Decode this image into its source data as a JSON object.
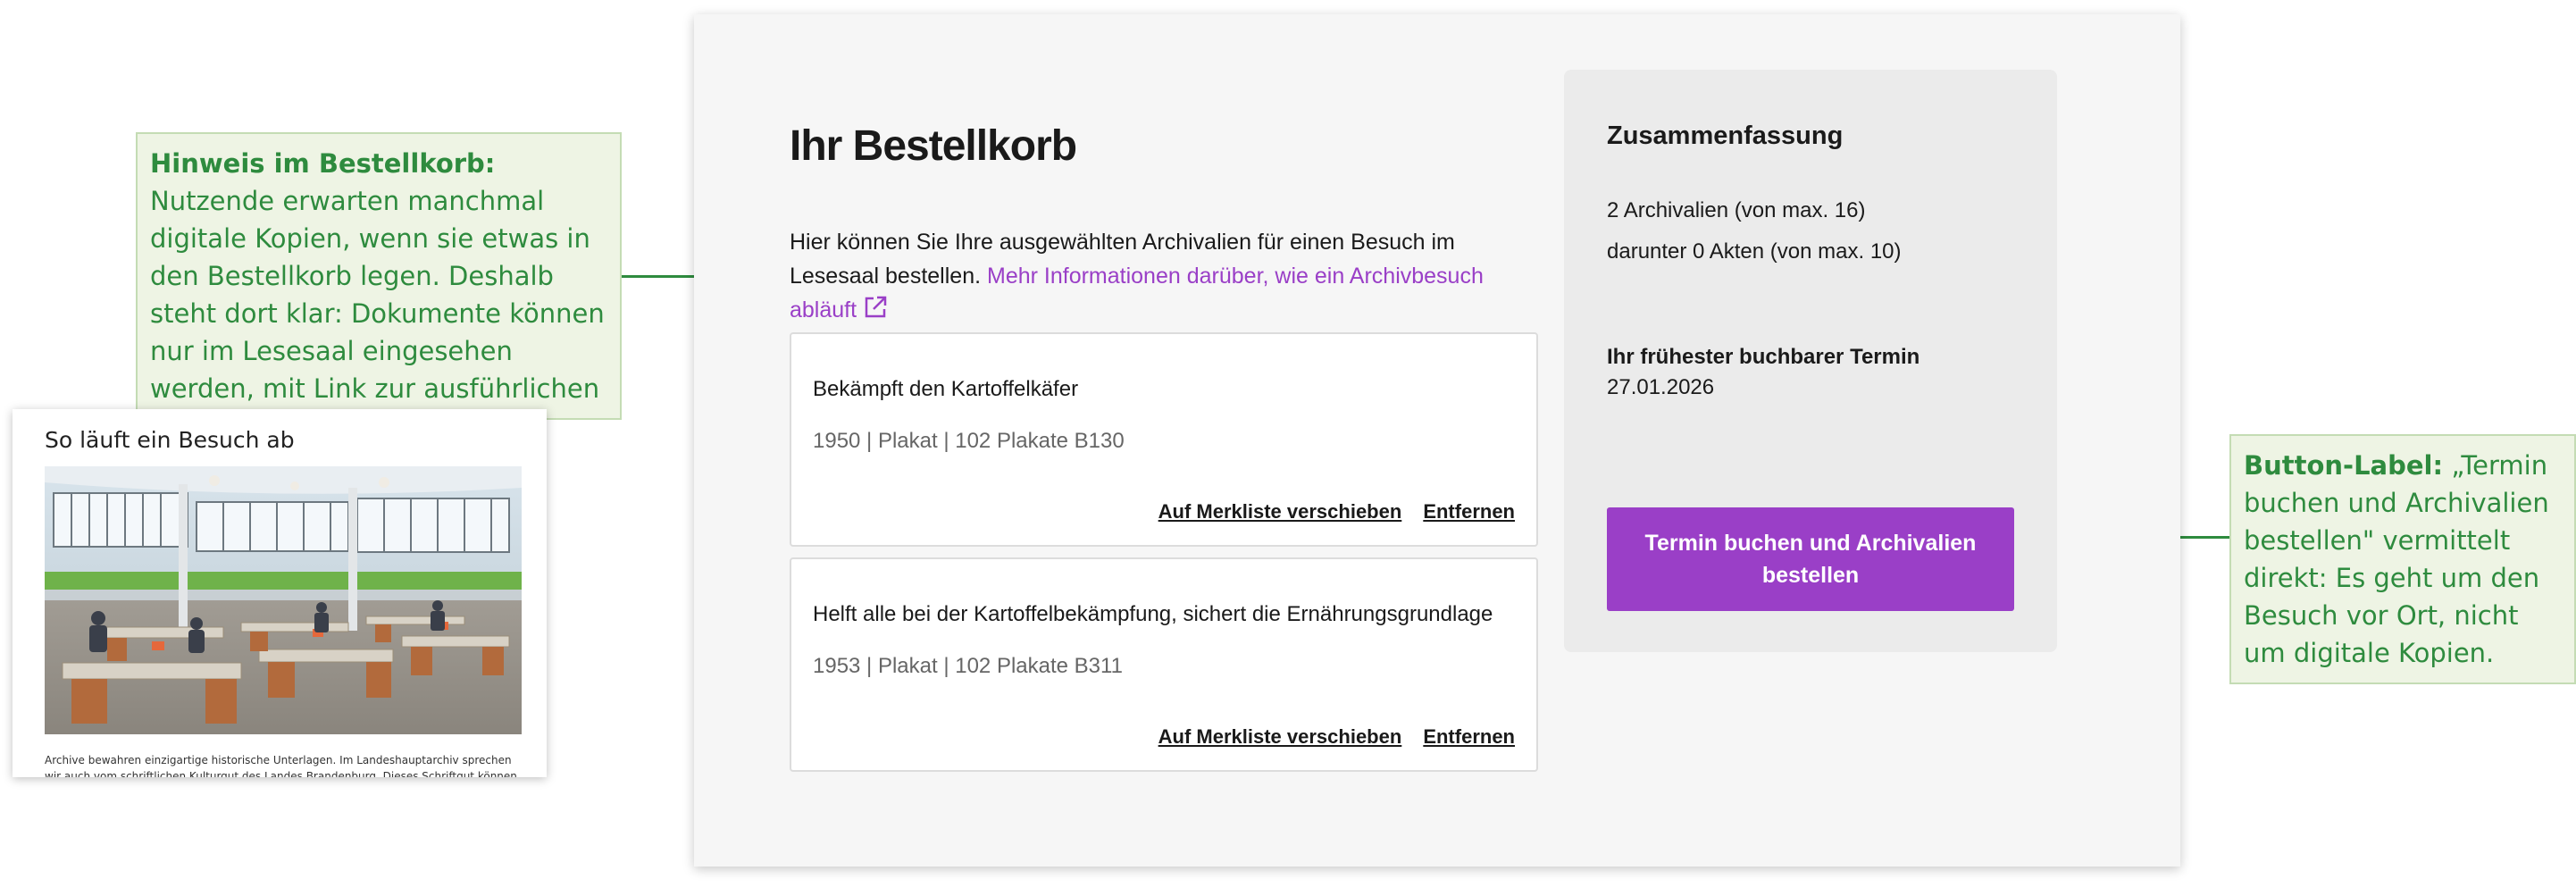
{
  "annotations": {
    "left": {
      "label": "Hinweis im Bestellkorb:",
      "text": "Nutzende erwarten manchmal digitale Kopien, wenn sie etwas in den Bestellkorb legen. Deshalb steht dort klar: Dokumente können nur im Lesesaal eingesehen werden, mit Link zur ausführlichen Erklärung."
    },
    "right": {
      "label": "Button-Label:",
      "text": "„Termin buchen und Archivalien bestellen\" vermittelt direkt: Es geht um den Besuch vor Ort, nicht um digitale Kopien."
    },
    "color": "#2e8b3e"
  },
  "thumbnail": {
    "title": "So läuft ein Besuch ab",
    "caption": "Archive bewahren einzigartige historische Unterlagen. Im Landeshauptarchiv sprechen wir auch vom schriftlichen Kulturgut des Landes Brandenburg. Dieses Schriftgut können Akten, Kar-"
  },
  "cart": {
    "title": "Ihr Bestellkorb",
    "intro_text": "Hier können Sie Ihre ausgewählten Archivalien für einen Besuch im Lesesaal bestellen.",
    "intro_link": "Mehr Informationen darüber, wie ein Archivbesuch abläuft",
    "items": [
      {
        "title": "Bekämpft den Kartoffelkäfer",
        "meta": "1950 | Plakat | 102 Plakate B130",
        "move_label": "Auf Merkliste verschieben",
        "remove_label": "Entfernen"
      },
      {
        "title": "Helft alle bei der Kartoffelbekämpfung, sichert die Ernährungsgrundlage",
        "meta": "1953 | Plakat | 102 Plakate B311",
        "move_label": "Auf Merkliste verschieben",
        "remove_label": "Entfernen"
      }
    ]
  },
  "summary": {
    "title": "Zusammenfassung",
    "archivalien": "2 Archivalien (von max. 16)",
    "akten": "darunter 0 Akten (von max. 10)",
    "earliest_label": "Ihr frühester buchbarer Termin",
    "earliest_date": "27.01.2026",
    "cta_label": "Termin buchen und Archivalien bestellen"
  },
  "colors": {
    "accent": "#9a3fc7",
    "annotation_bg": "#eef4e4",
    "annotation_border": "#c4dcb4"
  }
}
